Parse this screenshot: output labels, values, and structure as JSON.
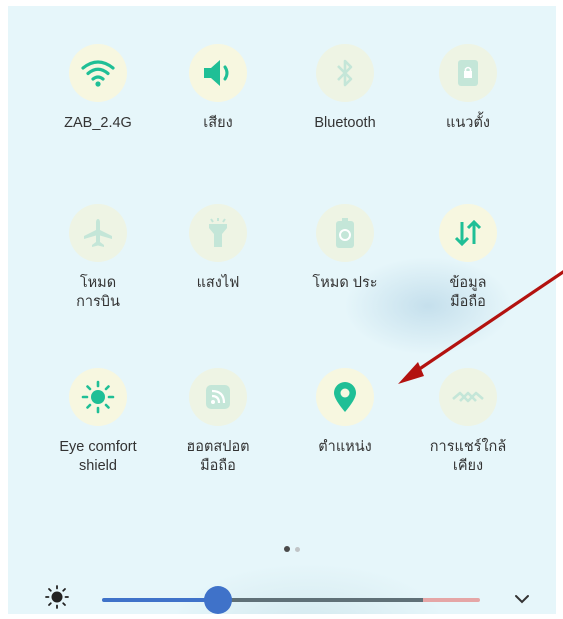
{
  "tiles": [
    {
      "label": "ZAB_2.4G",
      "icon": "wifi-icon",
      "state": "on"
    },
    {
      "label": "เสียง",
      "icon": "volume-icon",
      "state": "on"
    },
    {
      "label": "Bluetooth",
      "icon": "bluetooth-icon",
      "state": "off"
    },
    {
      "label": "แนวตั้ง",
      "icon": "portrait-lock-icon",
      "state": "off"
    },
    {
      "label": "โหมด\nการบิน",
      "icon": "airplane-icon",
      "state": "off"
    },
    {
      "label": "แสงไฟ",
      "icon": "flashlight-icon",
      "state": "off"
    },
    {
      "label": "โหมด ประ",
      "icon": "battery-saver-icon",
      "state": "off"
    },
    {
      "label": "ข้อมูล\nมือถือ",
      "icon": "mobile-data-icon",
      "state": "on"
    },
    {
      "label": "Eye comfort\nshield",
      "icon": "eye-comfort-icon",
      "state": "on"
    },
    {
      "label": "ฮอตสปอต\nมือถือ",
      "icon": "hotspot-icon",
      "state": "off"
    },
    {
      "label": "ตำแหน่ง",
      "icon": "location-icon",
      "state": "on"
    },
    {
      "label": "การแชร์ใกล้\nเคียง",
      "icon": "nearby-share-icon",
      "state": "off"
    }
  ],
  "page_indicator": {
    "current": 1,
    "total": 2
  },
  "brightness": {
    "level": 0.3
  },
  "colors": {
    "accent": "#1fbf96",
    "accent_off": "#c4e6d8",
    "slider": "#3f72c9",
    "annotation_arrow": "#b3120f"
  }
}
